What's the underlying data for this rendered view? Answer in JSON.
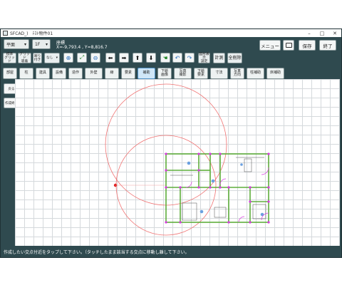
{
  "window": {
    "title": "SFCAD_)　ﾃｽﾄ物件01"
  },
  "toolbar": {
    "view_select": "平面",
    "floor_select": "1F",
    "coord_title": "座標",
    "coord_value": "X=-9,793.4 , Y=8,816.7",
    "menu_label": "メニュー",
    "save_label": "保存",
    "exit_label": "終了"
  },
  "tools": {
    "std_grid": "標準\nグリッド",
    "grid_snap": "グリッド\n吸着",
    "fit_snap": "寄り\n付き",
    "none_select": "なし",
    "dims_settings": "図形表示\n設定",
    "measure": "計測",
    "clear_all": "全削除"
  },
  "categories": [
    "部屋",
    "柱",
    "建具",
    "設備",
    "造作",
    "外壁",
    "線",
    "要素",
    "補助",
    "下絵\n画像",
    "写真\n撮影",
    "下絵\n要素",
    "寸法",
    "写真\n方向",
    "柱補助",
    "床補助"
  ],
  "active_category": 8,
  "side": {
    "back_label": "戻る",
    "done_label": "作成終了"
  },
  "status": {
    "message": "作成したい交点付近をタップして下さい。（タッチしたまま該当する交点に移動し離して下さい。"
  },
  "colors": {
    "frame": "#2f4a4f",
    "wall": "#5fae3c",
    "circle": "#f07070",
    "marker": "#d63adf",
    "accent": "#4d8fc4"
  }
}
